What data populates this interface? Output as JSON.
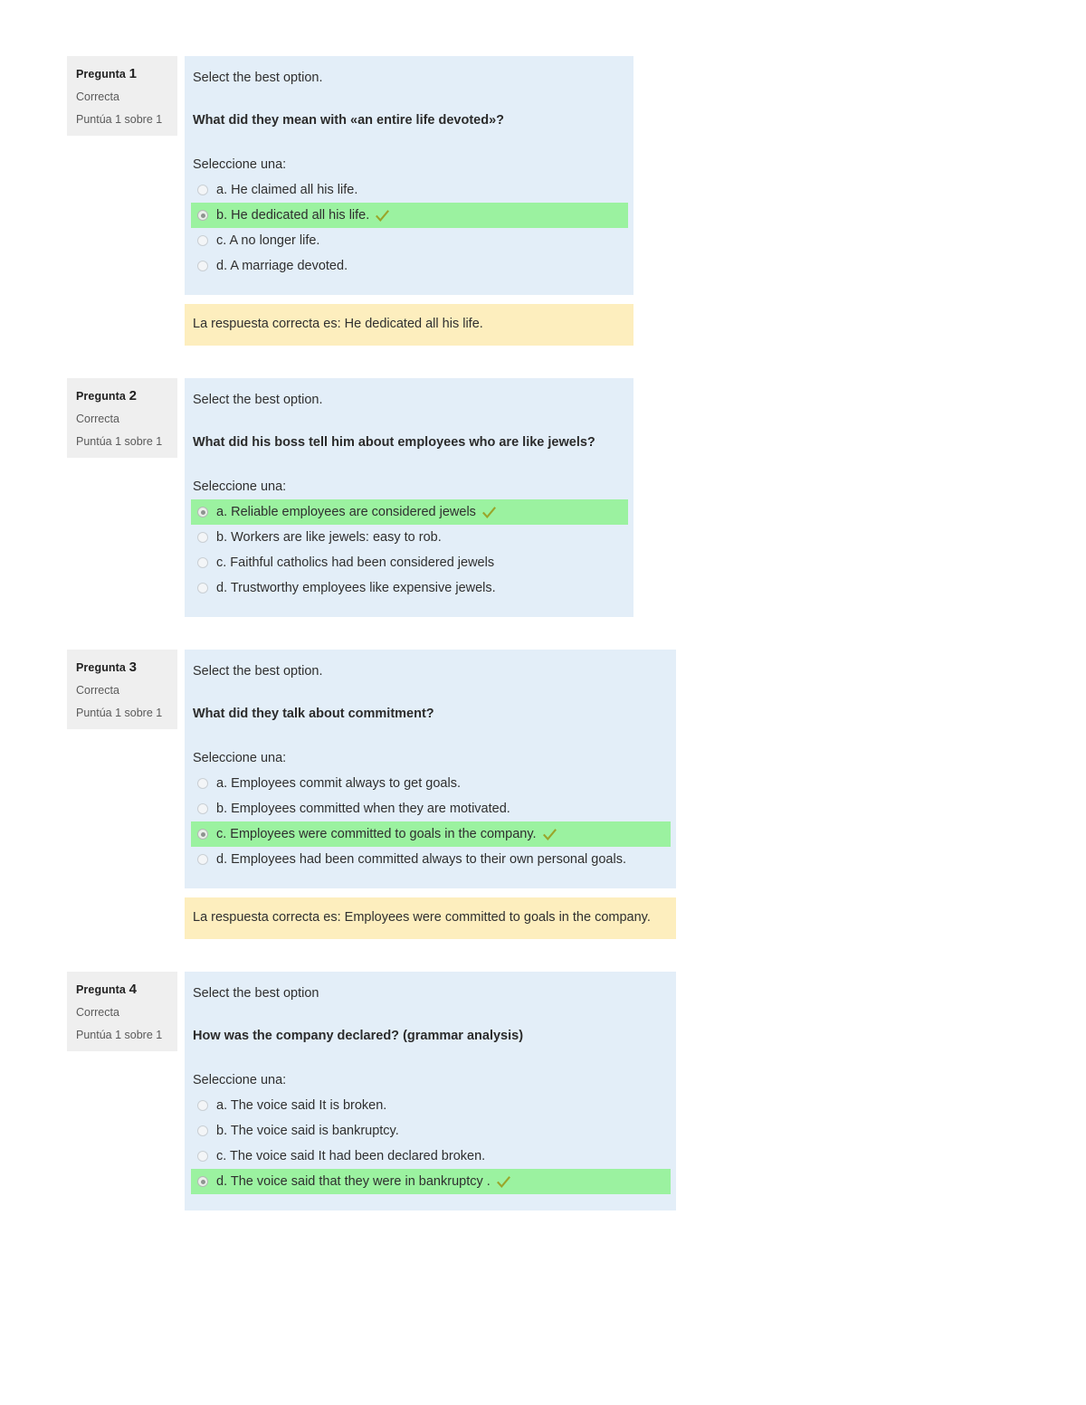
{
  "theme": {
    "question_body_bg": "#e3eef8",
    "info_bg": "#efefef",
    "correct_answer_bg": "#9bf2a0",
    "feedback_bg": "#fdeebe",
    "tick_color": "#9aa52a",
    "text_color": "#2f2f2f"
  },
  "labels": {
    "question_word": "Pregunta",
    "select_prompt": "Seleccione una:"
  },
  "questions": [
    {
      "number": "1",
      "info_title_word": "Pregunta",
      "state": "Correcta",
      "grade": "Puntúa 1 sobre 1",
      "intro": "Select the best option.",
      "stem": "What did they mean with «an entire life devoted»?",
      "prompt": "Seleccione una:",
      "width": "narrow",
      "answers": [
        {
          "label": "a. He claimed all his life.",
          "correct": false
        },
        {
          "label": "b. He dedicated all his life.",
          "correct": true
        },
        {
          "label": "c. A no longer life.",
          "correct": false
        },
        {
          "label": "d. A marriage devoted.",
          "correct": false
        }
      ],
      "feedback": "La respuesta correcta es: He dedicated all his life."
    },
    {
      "number": "2",
      "info_title_word": "Pregunta",
      "state": "Correcta",
      "grade": "Puntúa 1 sobre 1",
      "intro": "Select the best option.",
      "stem": "What did his boss tell him about employees who are like jewels?",
      "prompt": "Seleccione una:",
      "width": "narrow",
      "answers": [
        {
          "label": "a. Reliable employees are considered jewels",
          "correct": true
        },
        {
          "label": "b. Workers are like jewels: easy to rob.",
          "correct": false
        },
        {
          "label": "c. Faithful catholics had been considered jewels",
          "correct": false
        },
        {
          "label": "d. Trustworthy employees like expensive jewels.",
          "correct": false
        }
      ],
      "feedback": null
    },
    {
      "number": "3",
      "info_title_word": "Pregunta",
      "state": "Correcta",
      "grade": "Puntúa 1 sobre 1",
      "intro": "Select the best option.",
      "stem": "What did they talk about commitment?",
      "prompt": "Seleccione una:",
      "width": "wide",
      "answers": [
        {
          "label": "a. Employees commit always to get goals.",
          "correct": false
        },
        {
          "label": "b. Employees committed when they are motivated.",
          "correct": false
        },
        {
          "label": "c. Employees were committed to goals in the company.",
          "correct": true
        },
        {
          "label": "d. Employees had been committed always to their own personal goals.",
          "correct": false
        }
      ],
      "feedback": "La respuesta correcta es: Employees were committed to goals in the company."
    },
    {
      "number": "4",
      "info_title_word": "Pregunta",
      "state": "Correcta",
      "grade": "Puntúa 1 sobre 1",
      "intro": "Select the best option",
      "stem": "How was the company declared? (grammar analysis)",
      "prompt": "Seleccione una:",
      "width": "wide",
      "answers": [
        {
          "label": "a. The voice said It is broken.",
          "correct": false
        },
        {
          "label": "b. The voice said is bankruptcy.",
          "correct": false
        },
        {
          "label": "c. The voice said It had been declared broken.",
          "correct": false
        },
        {
          "label": "d. The voice said that they were in bankruptcy .",
          "correct": true
        }
      ],
      "feedback": null
    }
  ]
}
